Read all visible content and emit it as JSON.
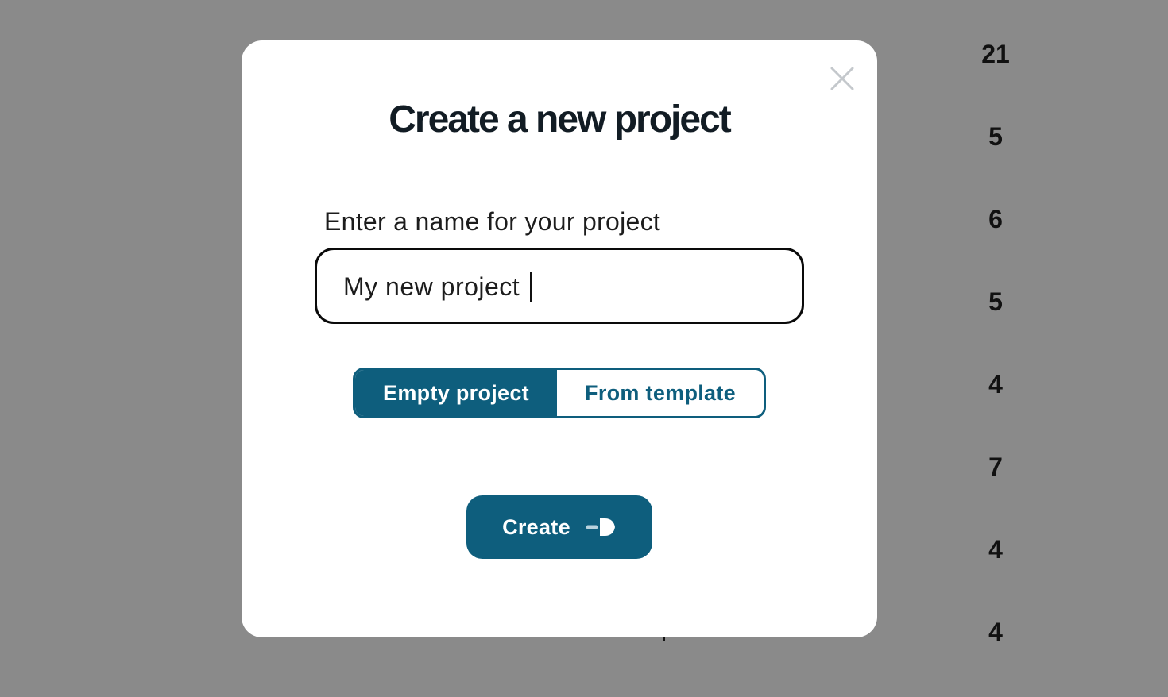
{
  "modal": {
    "title": "Create a new project",
    "name_field": {
      "label": "Enter a name for your project",
      "value": "My new project",
      "placeholder": ""
    },
    "project_type": {
      "options": [
        {
          "label": "Empty project",
          "selected": true
        },
        {
          "label": "From template",
          "selected": false
        }
      ]
    },
    "create_button": {
      "label": "Create",
      "icon": "arrow-right-icon"
    },
    "close_icon": "close-icon"
  },
  "background": {
    "counts": [
      "21",
      "5",
      "6",
      "5",
      "4",
      "7",
      "4",
      "4"
    ]
  },
  "colors": {
    "accent": "#0e5e7d",
    "overlay": "#8a8a8a",
    "title": "#121c24"
  }
}
